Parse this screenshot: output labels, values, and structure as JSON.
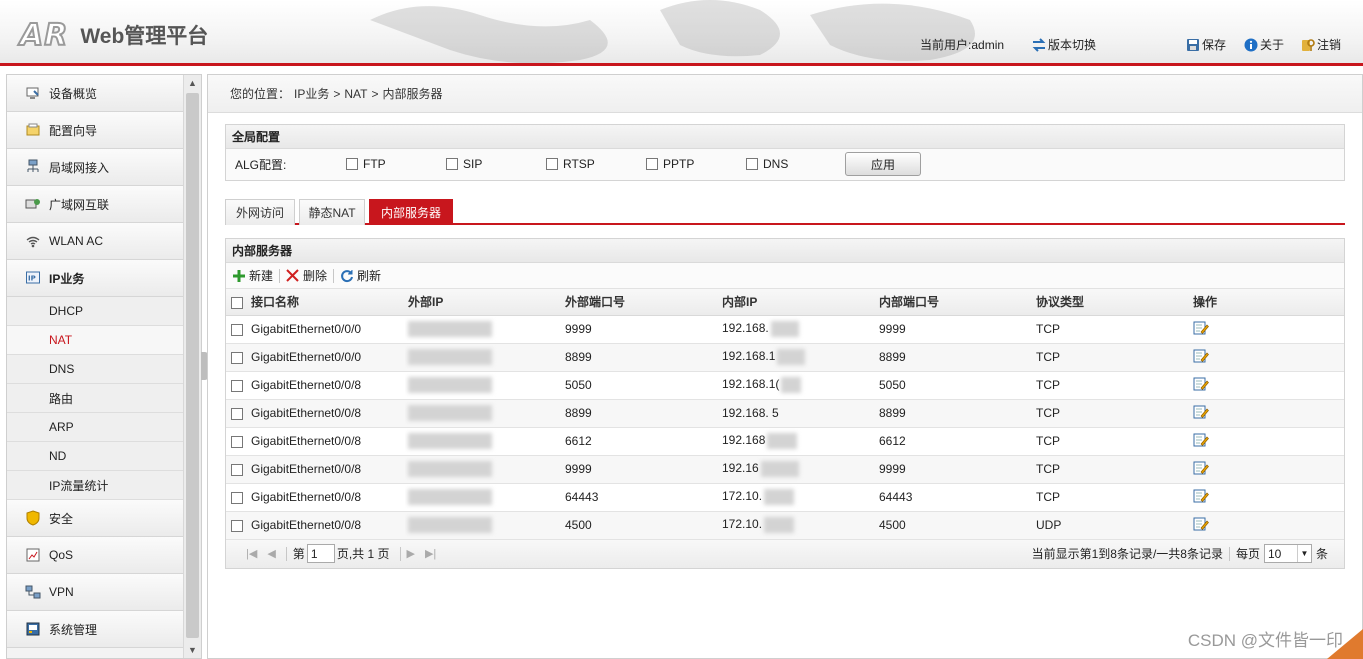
{
  "header": {
    "logo": "AR",
    "title": "Web管理平台",
    "user_prefix": "当前用户: ",
    "user_name": "admin",
    "version_switch": "版本切换",
    "save": "保存",
    "about": "关于",
    "logout": "注销",
    "accent_color": "#c8161d"
  },
  "sidebar": {
    "items": [
      {
        "label": "设备概览",
        "icon": "monitor-icon"
      },
      {
        "label": "配置向导",
        "icon": "wizard-icon"
      },
      {
        "label": "局域网接入",
        "icon": "lan-icon"
      },
      {
        "label": "广域网互联",
        "icon": "wan-icon"
      },
      {
        "label": "WLAN AC",
        "icon": "wifi-icon"
      },
      {
        "label": "IP业务",
        "icon": "ip-icon"
      },
      {
        "label": "安全",
        "icon": "shield-icon"
      },
      {
        "label": "QoS",
        "icon": "qos-icon"
      },
      {
        "label": "VPN",
        "icon": "vpn-icon"
      },
      {
        "label": "系统管理",
        "icon": "system-icon"
      }
    ],
    "sub_items": [
      "DHCP",
      "NAT",
      "DNS",
      "路由",
      "ARP",
      "ND",
      "IP流量统计"
    ],
    "active_sub": "NAT"
  },
  "breadcrumb": {
    "prefix": "您的位置：",
    "path1": "IP业务",
    "sep": ">",
    "path2": "NAT",
    "path3": "内部服务器"
  },
  "global": {
    "title": "全局配置",
    "alg_label": "ALG配置:",
    "options": [
      "FTP",
      "SIP",
      "RTSP",
      "PPTP",
      "DNS"
    ],
    "apply": "应用"
  },
  "tabs": [
    "外网访问",
    "静态NAT",
    "内部服务器"
  ],
  "active_tab": "内部服务器",
  "server_panel": {
    "title": "内部服务器",
    "toolbar": {
      "new": "新建",
      "delete": "删除",
      "refresh": "刷新"
    },
    "columns": [
      "接口名称",
      "外部IP",
      "外部端口号",
      "内部IP",
      "内部端口号",
      "协议类型",
      "操作"
    ],
    "rows": [
      {
        "iface": "GigabitEthernet0/0/0",
        "ext_port": "9999",
        "int_ip": "192.168.",
        "int_port": "9999",
        "proto": "TCP"
      },
      {
        "iface": "GigabitEthernet0/0/0",
        "ext_port": "8899",
        "int_ip": "192.168.1",
        "int_port": "8899",
        "proto": "TCP"
      },
      {
        "iface": "GigabitEthernet0/0/8",
        "ext_port": "5050",
        "int_ip": "192.168.1(",
        "int_port": "5050",
        "proto": "TCP"
      },
      {
        "iface": "GigabitEthernet0/0/8",
        "ext_port": "8899",
        "int_ip": "192.168.    5",
        "int_port": "8899",
        "proto": "TCP"
      },
      {
        "iface": "GigabitEthernet0/0/8",
        "ext_port": "6612",
        "int_ip": "192.168",
        "int_port": "6612",
        "proto": "TCP"
      },
      {
        "iface": "GigabitEthernet0/0/8",
        "ext_port": "9999",
        "int_ip": "192.16",
        "int_port": "9999",
        "proto": "TCP"
      },
      {
        "iface": "GigabitEthernet0/0/8",
        "ext_port": "64443",
        "int_ip": "172.10.",
        "int_port": "64443",
        "proto": "TCP"
      },
      {
        "iface": "GigabitEthernet0/0/8",
        "ext_port": "4500",
        "int_ip": "172.10.",
        "int_port": "4500",
        "proto": "UDP"
      }
    ]
  },
  "pager": {
    "page_prefix": "第",
    "page_value": "1",
    "page_suffix": "页,共 1 页",
    "summary": "当前显示第1到8条记录/一共8条记录",
    "per_page_label": "每页",
    "per_page_value": "10",
    "per_page_suffix": "条"
  },
  "watermark": "CSDN @文件皆一印"
}
